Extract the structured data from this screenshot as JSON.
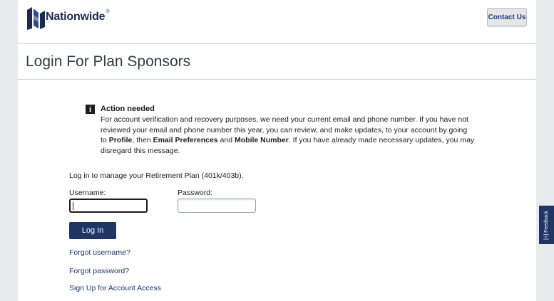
{
  "header": {
    "brand": "Nationwide",
    "brand_mark": "®",
    "contact_label": "Contact Us"
  },
  "page": {
    "title": "Login For Plan Sponsors"
  },
  "notice": {
    "heading": "Action needed",
    "icon": "info-icon",
    "text_1": "For account verification and recovery purposes, we need your current email and phone number. If you have not reviewed your email and phone number this year, you can review, and make updates, to your account by going to ",
    "bold_1": "Profile",
    "text_2": ", then ",
    "bold_2": "Email Preferences",
    "text_3": " and ",
    "bold_3": "Mobile Number",
    "text_4": ". If you have already made necessary updates, you may disregard this message."
  },
  "login": {
    "intro": "Log in to manage your Retirement Plan (401k/403b).",
    "username_label": "Username:",
    "password_label": "Password:",
    "username_value": "",
    "password_value": "",
    "submit_label": "Log In",
    "forgot_username": "Forgot username?",
    "forgot_password": "Forgot password?",
    "sign_up": "Sign Up for Account Access"
  },
  "feedback": {
    "label": "[+] Feedback"
  },
  "colors": {
    "brand_navy": "#1f3566",
    "page_bg": "#e9eaeb"
  }
}
